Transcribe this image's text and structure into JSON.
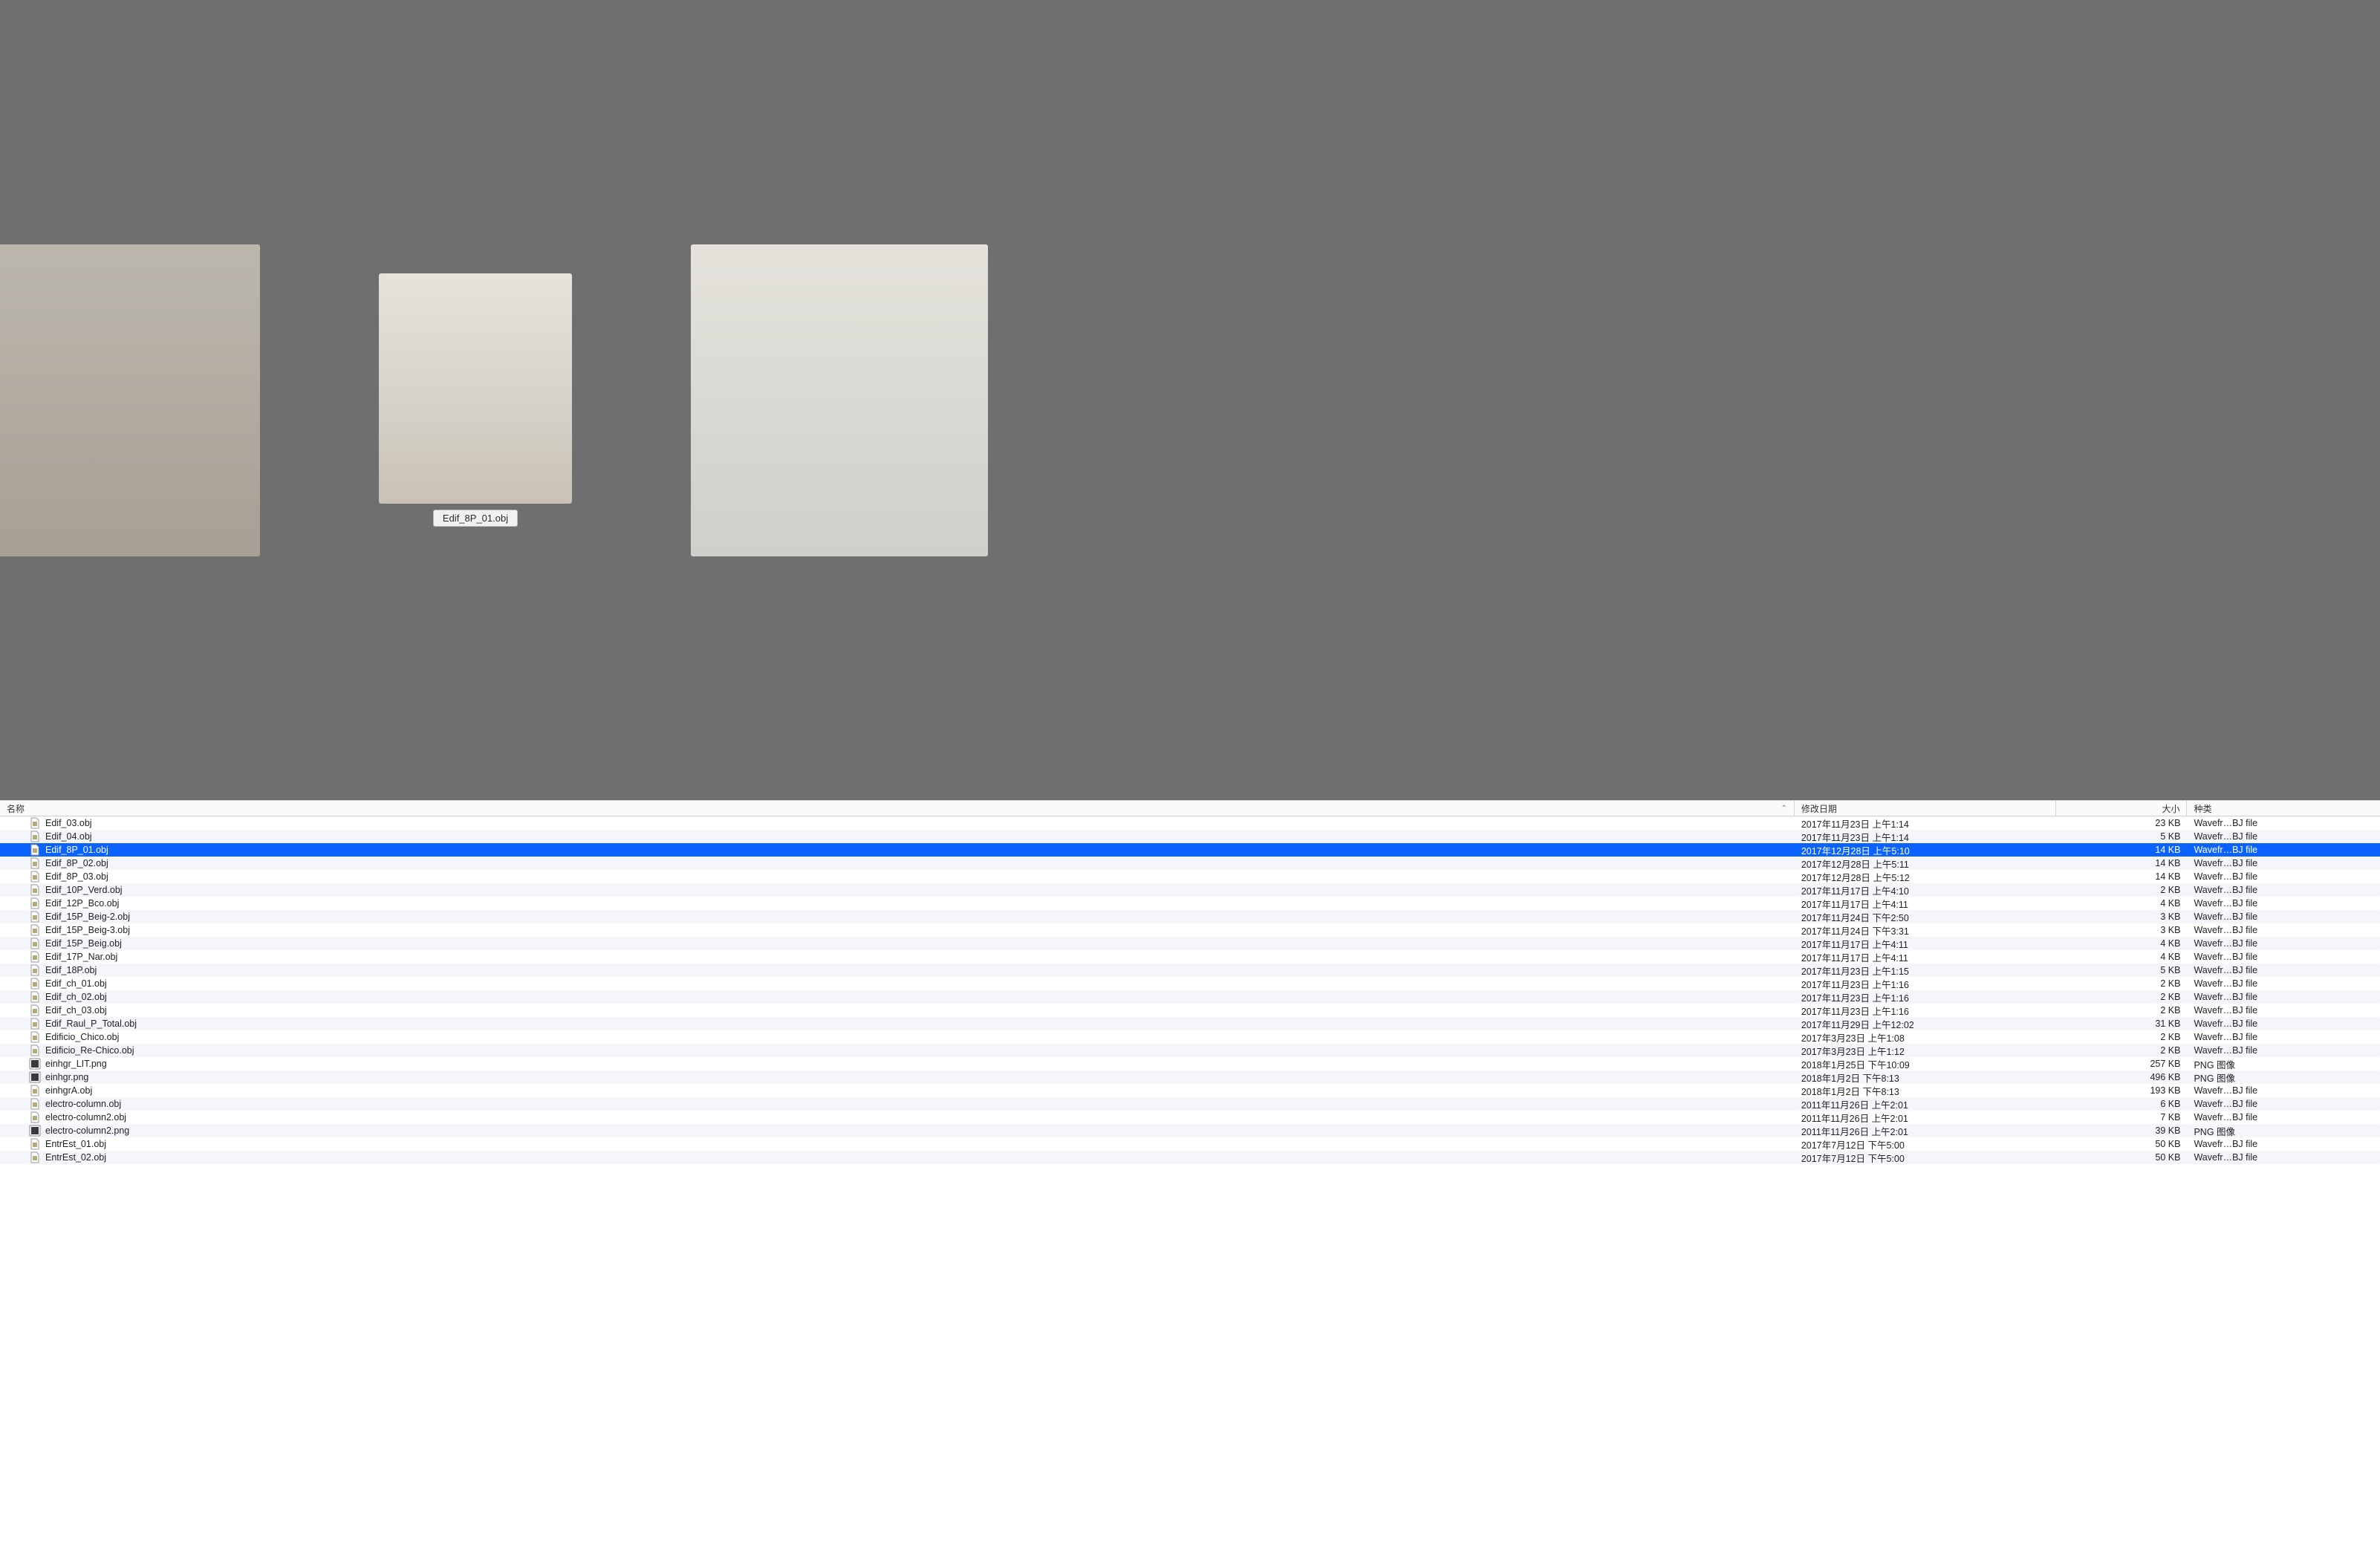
{
  "preview": {
    "selected_label": "Edif_8P_01.obj"
  },
  "columns": {
    "name": "名称",
    "date": "修改日期",
    "size": "大小",
    "kind": "种类",
    "sort_indicator": "⌃"
  },
  "rows": [
    {
      "icon": "obj",
      "name": "Edif_03.obj",
      "date": "2017年11月23日 上午1:14",
      "size": "23 KB",
      "kind": "Wavefr…BJ file",
      "selected": false
    },
    {
      "icon": "obj",
      "name": "Edif_04.obj",
      "date": "2017年11月23日 上午1:14",
      "size": "5 KB",
      "kind": "Wavefr…BJ file",
      "selected": false
    },
    {
      "icon": "obj",
      "name": "Edif_8P_01.obj",
      "date": "2017年12月28日 上午5:10",
      "size": "14 KB",
      "kind": "Wavefr…BJ file",
      "selected": true
    },
    {
      "icon": "obj",
      "name": "Edif_8P_02.obj",
      "date": "2017年12月28日 上午5:11",
      "size": "14 KB",
      "kind": "Wavefr…BJ file",
      "selected": false
    },
    {
      "icon": "obj",
      "name": "Edif_8P_03.obj",
      "date": "2017年12月28日 上午5:12",
      "size": "14 KB",
      "kind": "Wavefr…BJ file",
      "selected": false
    },
    {
      "icon": "obj",
      "name": "Edif_10P_Verd.obj",
      "date": "2017年11月17日 上午4:10",
      "size": "2 KB",
      "kind": "Wavefr…BJ file",
      "selected": false
    },
    {
      "icon": "obj",
      "name": "Edif_12P_Bco.obj",
      "date": "2017年11月17日 上午4:11",
      "size": "4 KB",
      "kind": "Wavefr…BJ file",
      "selected": false
    },
    {
      "icon": "obj",
      "name": "Edif_15P_Beig-2.obj",
      "date": "2017年11月24日 下午2:50",
      "size": "3 KB",
      "kind": "Wavefr…BJ file",
      "selected": false
    },
    {
      "icon": "obj",
      "name": "Edif_15P_Beig-3.obj",
      "date": "2017年11月24日 下午3:31",
      "size": "3 KB",
      "kind": "Wavefr…BJ file",
      "selected": false
    },
    {
      "icon": "obj",
      "name": "Edif_15P_Beig.obj",
      "date": "2017年11月17日 上午4:11",
      "size": "4 KB",
      "kind": "Wavefr…BJ file",
      "selected": false
    },
    {
      "icon": "obj",
      "name": "Edif_17P_Nar.obj",
      "date": "2017年11月17日 上午4:11",
      "size": "4 KB",
      "kind": "Wavefr…BJ file",
      "selected": false
    },
    {
      "icon": "obj",
      "name": "Edif_18P.obj",
      "date": "2017年11月23日 上午1:15",
      "size": "5 KB",
      "kind": "Wavefr…BJ file",
      "selected": false
    },
    {
      "icon": "obj",
      "name": "Edif_ch_01.obj",
      "date": "2017年11月23日 上午1:16",
      "size": "2 KB",
      "kind": "Wavefr…BJ file",
      "selected": false
    },
    {
      "icon": "obj",
      "name": "Edif_ch_02.obj",
      "date": "2017年11月23日 上午1:16",
      "size": "2 KB",
      "kind": "Wavefr…BJ file",
      "selected": false
    },
    {
      "icon": "obj",
      "name": "Edif_ch_03.obj",
      "date": "2017年11月23日 上午1:16",
      "size": "2 KB",
      "kind": "Wavefr…BJ file",
      "selected": false
    },
    {
      "icon": "obj",
      "name": "Edif_Raul_P_Total.obj",
      "date": "2017年11月29日 上午12:02",
      "size": "31 KB",
      "kind": "Wavefr…BJ file",
      "selected": false
    },
    {
      "icon": "obj",
      "name": "Edificio_Chico.obj",
      "date": "2017年3月23日 上午1:08",
      "size": "2 KB",
      "kind": "Wavefr…BJ file",
      "selected": false
    },
    {
      "icon": "obj",
      "name": "Edificio_Re-Chico.obj",
      "date": "2017年3月23日 上午1:12",
      "size": "2 KB",
      "kind": "Wavefr…BJ file",
      "selected": false
    },
    {
      "icon": "png",
      "name": "einhgr_LIT.png",
      "date": "2018年1月25日 下午10:09",
      "size": "257 KB",
      "kind": "PNG 图像",
      "selected": false
    },
    {
      "icon": "png",
      "name": "einhgr.png",
      "date": "2018年1月2日 下午8:13",
      "size": "496 KB",
      "kind": "PNG 图像",
      "selected": false
    },
    {
      "icon": "obj",
      "name": "einhgrA.obj",
      "date": "2018年1月2日 下午8:13",
      "size": "193 KB",
      "kind": "Wavefr…BJ file",
      "selected": false
    },
    {
      "icon": "obj",
      "name": "electro-column.obj",
      "date": "2011年11月26日 上午2:01",
      "size": "6 KB",
      "kind": "Wavefr…BJ file",
      "selected": false
    },
    {
      "icon": "obj",
      "name": "electro-column2.obj",
      "date": "2011年11月26日 上午2:01",
      "size": "7 KB",
      "kind": "Wavefr…BJ file",
      "selected": false
    },
    {
      "icon": "png",
      "name": "electro-column2.png",
      "date": "2011年11月26日 上午2:01",
      "size": "39 KB",
      "kind": "PNG 图像",
      "selected": false
    },
    {
      "icon": "obj",
      "name": "EntrEst_01.obj",
      "date": "2017年7月12日 下午5:00",
      "size": "50 KB",
      "kind": "Wavefr…BJ file",
      "selected": false
    },
    {
      "icon": "obj",
      "name": "EntrEst_02.obj",
      "date": "2017年7月12日 下午5:00",
      "size": "50 KB",
      "kind": "Wavefr…BJ file",
      "selected": false
    }
  ]
}
